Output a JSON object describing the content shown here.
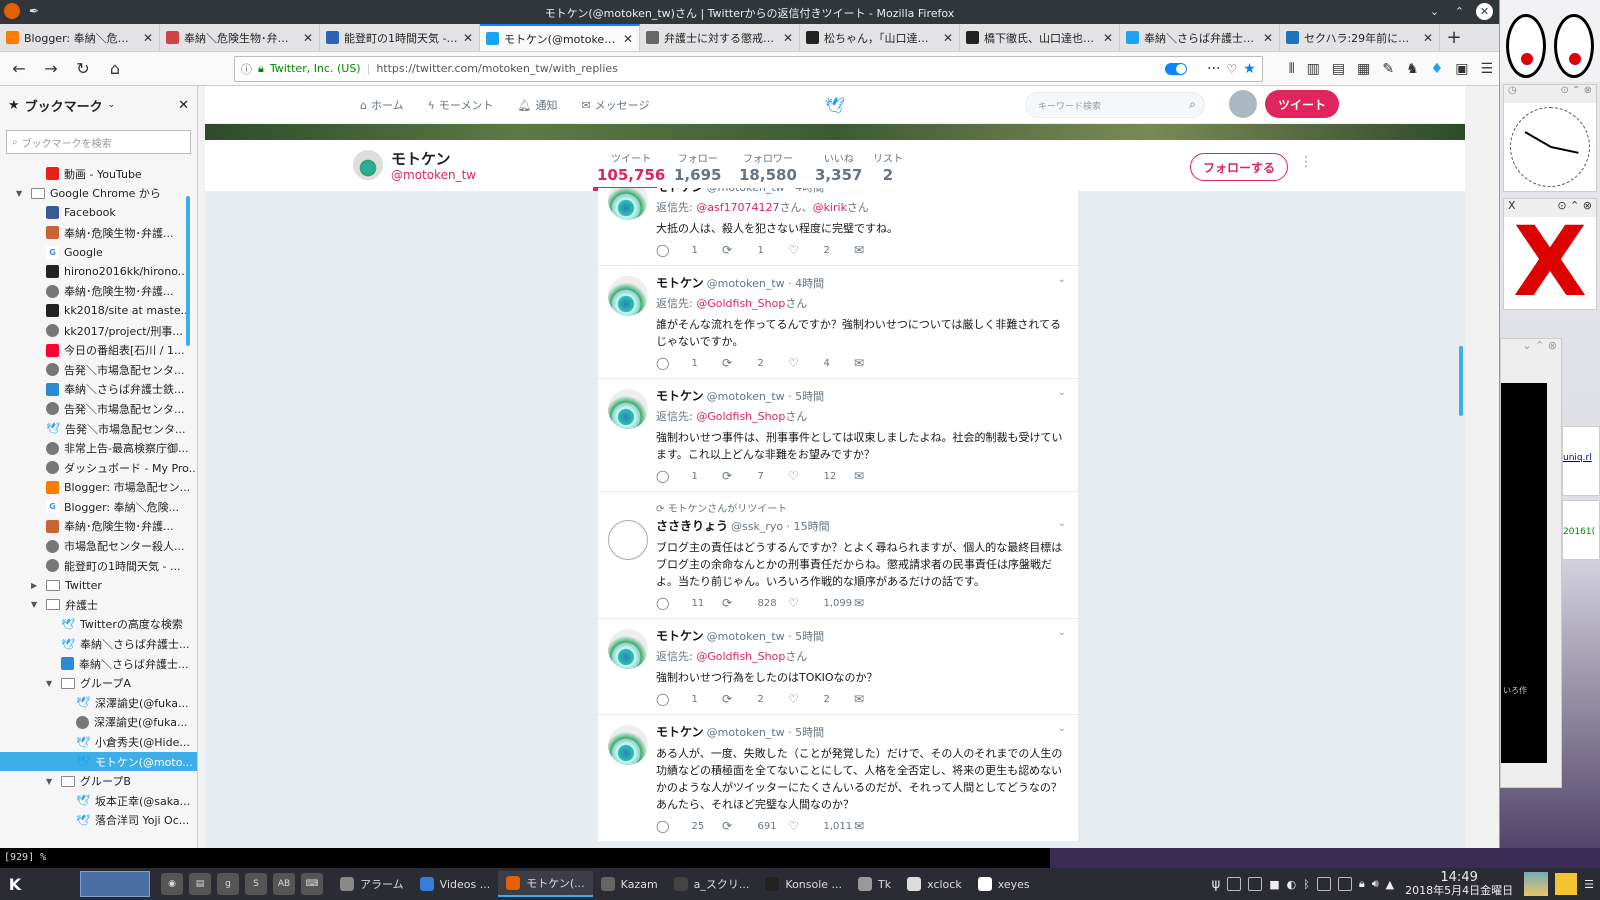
{
  "window": {
    "title": "モトケン(@motoken_tw)さん | Twitterからの返信付きツイート - Mozilla Firefox"
  },
  "tabs": [
    {
      "label": "Blogger: 奉納＼危険生",
      "color": "#f57d00",
      "active": false
    },
    {
      "label": "奉納＼危険生物･弁護士",
      "color": "#cc4444",
      "active": false
    },
    {
      "label": "能登町の1時間天気 - 日",
      "color": "#2a64b5",
      "active": false
    },
    {
      "label": "モトケン(@motoken_tw",
      "color": "#1da1f2",
      "active": true
    },
    {
      "label": "弁護士に対する懲戒請求",
      "color": "#666666",
      "active": false
    },
    {
      "label": "松ちゃん，｢山口達也メン",
      "color": "#222222",
      "active": false
    },
    {
      "label": "橋下徹氏、山口達也に｢",
      "color": "#222222",
      "active": false
    },
    {
      "label": "奉納＼さらば弁護士鉄道",
      "color": "#1da1f2",
      "active": false
    },
    {
      "label": "セクハラ:29年前に初の",
      "color": "#1e73be",
      "active": false
    }
  ],
  "navbar": {
    "site_identity": "Twitter, Inc. (US)",
    "url": "https://twitter.com/motoken_tw/with_replies"
  },
  "sidebar": {
    "title": "ブックマーク",
    "search_placeholder": "ブックマークを検索",
    "items": [
      {
        "label": "動画 - YouTube",
        "indent": 1,
        "kind": "yt"
      },
      {
        "label": "Google Chrome から",
        "indent": 0,
        "kind": "folder",
        "open": true
      },
      {
        "label": "Facebook",
        "indent": 1,
        "kind": "fb"
      },
      {
        "label": "奉納･危険生物･弁護...",
        "indent": 1,
        "kind": "img"
      },
      {
        "label": "Google",
        "indent": 1,
        "kind": "g"
      },
      {
        "label": "hirono2016kk/hirono...",
        "indent": 1,
        "kind": "gh"
      },
      {
        "label": "奉納･危険生物･弁護...",
        "indent": 1,
        "kind": "globe"
      },
      {
        "label": "kk2018/site at maste...",
        "indent": 1,
        "kind": "gh"
      },
      {
        "label": "kk2017/project/刑事...",
        "indent": 1,
        "kind": "globe"
      },
      {
        "label": "今日の番組表[石川 / 1...",
        "indent": 1,
        "kind": "y"
      },
      {
        "label": "告発＼市場急配センタ...",
        "indent": 1,
        "kind": "globe"
      },
      {
        "label": "奉納＼さらば弁護士鉄...",
        "indent": 1,
        "kind": "t"
      },
      {
        "label": "告発＼市場急配センタ...",
        "indent": 1,
        "kind": "globe"
      },
      {
        "label": "告発＼市場急配センタ...",
        "indent": 1,
        "kind": "tw"
      },
      {
        "label": "非常上告-最高検察庁御...",
        "indent": 1,
        "kind": "globe"
      },
      {
        "label": "ダッシュボード - My Pro...",
        "indent": 1,
        "kind": "globe"
      },
      {
        "label": "Blogger: 市場急配セン...",
        "indent": 1,
        "kind": "blogger"
      },
      {
        "label": "Blogger: 奉納＼危険...",
        "indent": 1,
        "kind": "g"
      },
      {
        "label": "奉納･危険生物･弁護...",
        "indent": 1,
        "kind": "img"
      },
      {
        "label": "市場急配センター殺人...",
        "indent": 1,
        "kind": "globe"
      },
      {
        "label": "能登町の1時間天気 - ...",
        "indent": 1,
        "kind": "globe"
      },
      {
        "label": "Twitter",
        "indent": 1,
        "kind": "folder",
        "open": false
      },
      {
        "label": "弁護士",
        "indent": 1,
        "kind": "folder",
        "open": true
      },
      {
        "label": "Twitterの高度な検索",
        "indent": 2,
        "kind": "tw"
      },
      {
        "label": "奉納＼さらば弁護士...",
        "indent": 2,
        "kind": "tw"
      },
      {
        "label": "奉納＼さらば弁護士...",
        "indent": 2,
        "kind": "t"
      },
      {
        "label": "グループA",
        "indent": 2,
        "kind": "folder",
        "open": true
      },
      {
        "label": "深澤諭史(@fuka...",
        "indent": 3,
        "kind": "tw"
      },
      {
        "label": "深澤諭史(@fuka...",
        "indent": 3,
        "kind": "globe"
      },
      {
        "label": "小倉秀夫(@Hide...",
        "indent": 3,
        "kind": "tw"
      },
      {
        "label": "モトケン(@moto...",
        "indent": 3,
        "kind": "tw",
        "selected": true
      },
      {
        "label": "グループB",
        "indent": 2,
        "kind": "folder",
        "open": true
      },
      {
        "label": "坂本正幸(@saka...",
        "indent": 3,
        "kind": "tw"
      },
      {
        "label": "落合洋司 Yoji Oc...",
        "indent": 3,
        "kind": "tw"
      }
    ]
  },
  "twitter": {
    "nav": {
      "home": "ホーム",
      "moments": "モーメント",
      "notifications": "通知",
      "messages": "メッセージ"
    },
    "search_placeholder": "キーワード検索",
    "tweet_button": "ツイート",
    "profile": {
      "name": "モトケン",
      "handle": "@motoken_tw",
      "follow_button": "フォローする"
    },
    "stats": [
      {
        "label": "ツイート",
        "value": "105,756",
        "active": true
      },
      {
        "label": "フォロー",
        "value": "1,695",
        "active": false
      },
      {
        "label": "フォロワー",
        "value": "18,580",
        "active": false
      },
      {
        "label": "いいね",
        "value": "3,357",
        "active": false
      },
      {
        "label": "リスト",
        "value": "2",
        "active": false
      }
    ],
    "tweets": [
      {
        "name": "モトケン",
        "handle": "@motoken_tw",
        "time": "4時間",
        "reply_to": [
          "@asf17074127",
          "@kirik"
        ],
        "text": "大抵の人は、殺人を犯さない程度に完璧ですね。",
        "replies": "1",
        "retweets": "1",
        "likes": "2"
      },
      {
        "name": "モトケン",
        "handle": "@motoken_tw",
        "time": "4時間",
        "reply_to": [
          "@Goldfish_Shop"
        ],
        "text": "誰がそんな流れを作ってるんですか？強制わいせつについては厳しく非難されてるじゃないですか。",
        "replies": "1",
        "retweets": "2",
        "likes": "4"
      },
      {
        "name": "モトケン",
        "handle": "@motoken_tw",
        "time": "5時間",
        "reply_to": [
          "@Goldfish_Shop"
        ],
        "text": "強制わいせつ事件は、刑事事件としては収束しましたよね。社会的制裁も受けています。これ以上どんな非難をお望みですか？",
        "replies": "1",
        "retweets": "7",
        "likes": "12"
      },
      {
        "retweet_note": "モトケンさんがリツイート",
        "name": "ささきりょう",
        "handle": "@ssk_ryo",
        "time": "15時間",
        "reply_to": [],
        "text": "ブログ主の責任はどうするんですか？とよく尋ねられますが、個人的な最終目標はブログ主の余命なんとかの刑事責任だからね。懲戒請求者の民事責任は序盤戦だよ。当たり前じゃん。いろいろ作戦的な順序があるだけの話です。",
        "replies": "11",
        "retweets": "828",
        "likes": "1,099",
        "human": true
      },
      {
        "name": "モトケン",
        "handle": "@motoken_tw",
        "time": "5時間",
        "reply_to": [
          "@Goldfish_Shop"
        ],
        "text": "強制わいせつ行為をしたのはTOKIOなのか？",
        "replies": "1",
        "retweets": "2",
        "likes": "2"
      },
      {
        "name": "モトケン",
        "handle": "@motoken_tw",
        "time": "5時間",
        "reply_to": [],
        "text": "ある人が、一度、失敗した（ことが発覚した）だけで、その人のそれまでの人生の功績などの積極面を全てないことにして、人格を全否定し、将来の更生も認めないかのような人がツイッターにたくさんいるのだが、それって人間としてどうなの？あんたら、それほど完璧な人間なのか？",
        "replies": "25",
        "retweets": "691",
        "likes": "1,011"
      }
    ],
    "reply_prefix": "返信先:",
    "reply_suffix": "さん"
  },
  "console": {
    "text": "[929]  %"
  },
  "right_widgets": {
    "win4_text": "uniq.rl",
    "win5_text": "20161(",
    "win3_text": "いろ作"
  },
  "taskbar": {
    "tasks": [
      {
        "label": "アラーム",
        "color": "#888888"
      },
      {
        "label": "Videos ...",
        "color": "#3a7bd5"
      },
      {
        "label": "モトケン(...",
        "color": "#e66000",
        "active": true
      },
      {
        "label": "Kazam",
        "color": "#666666"
      },
      {
        "label": "a_スクリ...",
        "color": "#444444"
      },
      {
        "label": "Konsole ...",
        "color": "#222222"
      },
      {
        "label": "Tk",
        "color": "#999999"
      },
      {
        "label": "xclock",
        "color": "#dddddd"
      },
      {
        "label": "xeyes",
        "color": "#ffffff"
      }
    ],
    "time": "14:49",
    "date": "2018年5月4日金曜日"
  }
}
